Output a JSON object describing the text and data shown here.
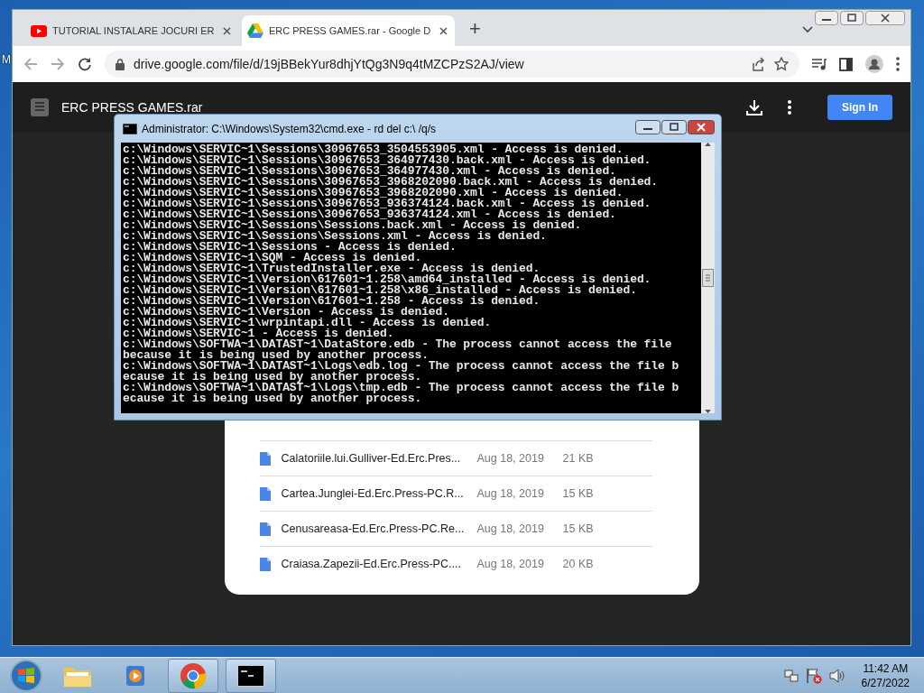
{
  "desktop": {
    "icon_label": "M"
  },
  "browser": {
    "tabs": [
      {
        "title": "TUTORIAL INSTALARE JOCURI ER",
        "kind": "video",
        "selected": false
      },
      {
        "title": "ERC PRESS GAMES.rar - Google D",
        "kind": "drive",
        "selected": true
      }
    ],
    "new_tab": "+",
    "address": "drive.google.com/file/d/19jBBekYur8dhjYtQg3N9q4tMZCPzS2AJ/view"
  },
  "drive": {
    "title": "ERC PRESS GAMES.rar",
    "sign_in": "Sign In",
    "files": [
      {
        "name": "Calatoriile.lui.Gulliver-Ed.Erc.Pres...",
        "date": "Aug 18, 2019",
        "size": "21 KB"
      },
      {
        "name": "Cartea.Junglei-Ed.Erc.Press-PC.R...",
        "date": "Aug 18, 2019",
        "size": "15 KB"
      },
      {
        "name": "Cenusareasa-Ed.Erc.Press-PC.Re...",
        "date": "Aug 18, 2019",
        "size": "15 KB"
      },
      {
        "name": "Craiasa.Zapezii-Ed.Erc.Press-PC....",
        "date": "Aug 18, 2019",
        "size": "20 KB"
      }
    ]
  },
  "cmd": {
    "title": "Administrator: C:\\Windows\\System32\\cmd.exe - rd  del c:\\ /q/s",
    "lines": [
      "c:\\Windows\\SERVIC~1\\Sessions\\30967653_3504553905.xml - Access is denied.",
      "c:\\Windows\\SERVIC~1\\Sessions\\30967653_364977430.back.xml - Access is denied.",
      "c:\\Windows\\SERVIC~1\\Sessions\\30967653_364977430.xml - Access is denied.",
      "c:\\Windows\\SERVIC~1\\Sessions\\30967653_3968202090.back.xml - Access is denied.",
      "c:\\Windows\\SERVIC~1\\Sessions\\30967653_3968202090.xml - Access is denied.",
      "c:\\Windows\\SERVIC~1\\Sessions\\30967653_936374124.back.xml - Access is denied.",
      "c:\\Windows\\SERVIC~1\\Sessions\\30967653_936374124.xml - Access is denied.",
      "c:\\Windows\\SERVIC~1\\Sessions\\Sessions.back.xml - Access is denied.",
      "c:\\Windows\\SERVIC~1\\Sessions\\Sessions.xml - Access is denied.",
      "c:\\Windows\\SERVIC~1\\Sessions - Access is denied.",
      "c:\\Windows\\SERVIC~1\\SQM - Access is denied.",
      "c:\\Windows\\SERVIC~1\\TrustedInstaller.exe - Access is denied.",
      "c:\\Windows\\SERVIC~1\\Version\\617601~1.258\\amd64_installed - Access is denied.",
      "c:\\Windows\\SERVIC~1\\Version\\617601~1.258\\x86_installed - Access is denied.",
      "c:\\Windows\\SERVIC~1\\Version\\617601~1.258 - Access is denied.",
      "c:\\Windows\\SERVIC~1\\Version - Access is denied.",
      "c:\\Windows\\SERVIC~1\\wrpintapi.dll - Access is denied.",
      "c:\\Windows\\SERVIC~1 - Access is denied.",
      "c:\\Windows\\SOFTWA~1\\DATAST~1\\DataStore.edb - The process cannot access the file",
      "because it is being used by another process.",
      "c:\\Windows\\SOFTWA~1\\DATAST~1\\Logs\\edb.log - The process cannot access the file b",
      "ecause it is being used by another process.",
      "c:\\Windows\\SOFTWA~1\\DATAST~1\\Logs\\tmp.edb - The process cannot access the file b",
      "ecause it is being used by another process."
    ]
  },
  "taskbar": {
    "apps": [
      {
        "kind": "folder",
        "running": false
      },
      {
        "kind": "media",
        "running": false
      },
      {
        "kind": "browser",
        "running": true
      },
      {
        "kind": "console",
        "running": true
      }
    ],
    "time": "11:42 AM",
    "date": "6/27/2022"
  }
}
